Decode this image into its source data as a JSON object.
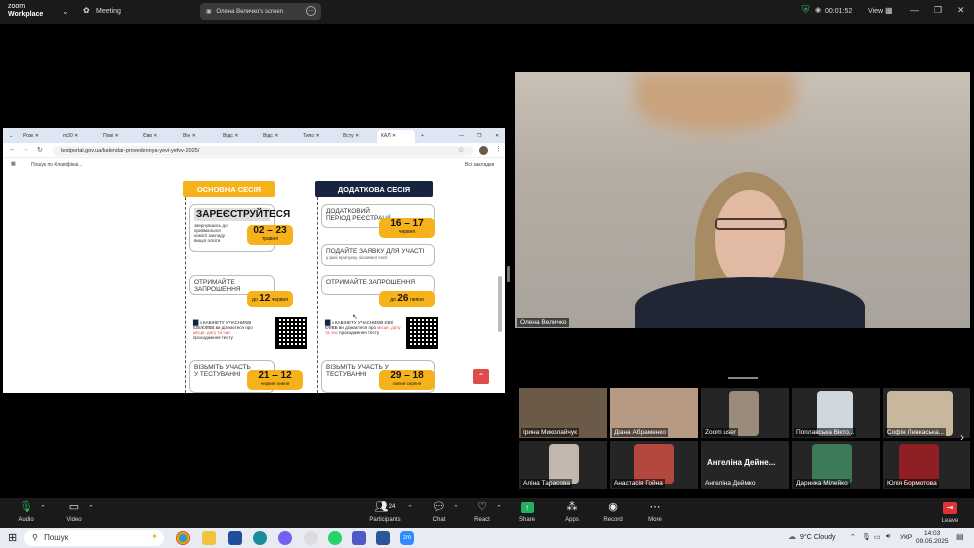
{
  "app": {
    "logo_line1": "zoom",
    "logo_line2": "Workplace",
    "meeting_label": "Meeting",
    "share_pill": "Олена Величко's screen",
    "timer": "00:01:52",
    "view_label": "View"
  },
  "browser": {
    "tabs": [
      "Розк",
      "m30",
      "Пові",
      "Євв",
      "Він",
      "Відс",
      "Відс",
      "Типо",
      "Всту",
      "КАЛ"
    ],
    "url": "testportal.gov.ua/kalendar-provedennya-yevi-yefvv-2025/",
    "bookmarks_search": "Пошук по Клавіфікаі...",
    "bookmarks_all": "Всі закладки"
  },
  "calendar": {
    "main_title": "ОСНОВНА СЕСІЯ",
    "extra_title": "ДОДАТКОВА СЕСІЯ",
    "register_heading": "ЗАРЕЄСТРУЙТЕСЯ",
    "register_note": "звернувшись до приймальної комісії закладу вищої освіти",
    "register_dates": "02 – 23",
    "register_month": "травня",
    "extra_reg_heading": "ДОДАТКОВИЙ ПЕРІОД РЕЄСТРАЦІЇ",
    "extra_reg_dates": "16 – 17",
    "extra_reg_month": "червня",
    "apply_heading": "ПОДАЙТЕ ЗАЯВКУ ДЛЯ УЧАСТІ",
    "apply_note": "у разі пропуску основної сесії",
    "invite_heading": "ОТРИМАЙТЕ ЗАПРОШЕННЯ",
    "invite_main_prefix": "до",
    "invite_main_day": "12",
    "invite_main_month": "червня",
    "invite_extra_prefix": "до",
    "invite_extra_day": "26",
    "invite_extra_month": "липня",
    "cabinet_line1": "з КАБІНЕТУ УЧАСНИКІВ ЄВІ/ЄФВВ ви дізнаєтеся",
    "cabinet_line2": "про",
    "cabinet_highlight": "місце, дату та час",
    "cabinet_line3": "проходження тесту",
    "test_heading": "ВІЗЬМІТЬ УЧАСТЬ У ТЕСТУВАННІ",
    "test_main_dates": "21 – 12",
    "test_main_months": "червня  липня",
    "test_extra_dates": "29 – 18",
    "test_extra_months": "липня  серпня"
  },
  "main_speaker": {
    "name": "Олена Величко"
  },
  "gallery": [
    {
      "name": "Ірина Миколайчук",
      "color": "#6b5a48"
    },
    {
      "name": "Діана Абраменко",
      "color": "#b79a84"
    },
    {
      "name": "Zoom user",
      "color": "#9a8c7a"
    },
    {
      "name": "Поплавська Вікто...",
      "color": "#cfd6dc"
    },
    {
      "name": "Софія Левкаська...",
      "color": "#c7b79c"
    },
    {
      "name": "Аліна Тарасова",
      "color": "#c2b8ae"
    },
    {
      "name": "Анастасія Гойна",
      "color": "#b4473e"
    },
    {
      "name": "Ангеліна Деймко",
      "big_name": "Ангеліна  Дейне...",
      "color": "#252525"
    },
    {
      "name": "Даринка Мілейко",
      "color": "#3d7a57"
    },
    {
      "name": "Юлія Бормотова",
      "color": "#8f1f24"
    }
  ],
  "toolbar": {
    "audio": "Audio",
    "video": "Video",
    "participants": "Participants",
    "participants_count": "24",
    "chat": "Chat",
    "react": "React",
    "share": "Share",
    "apps": "Apps",
    "record": "Record",
    "more": "More",
    "leave": "Leave"
  },
  "taskbar": {
    "search": "Пошук",
    "weather": "9°C  Cloudy",
    "lang": "УКР",
    "time": "14:03",
    "date": "09.05.2025"
  },
  "colors": {
    "share_green": "#23b35c",
    "leave_red": "#e03232",
    "calendar_yellow": "#f6b21b",
    "calendar_navy": "#17243f",
    "highlight_red": "#e04a4a"
  }
}
